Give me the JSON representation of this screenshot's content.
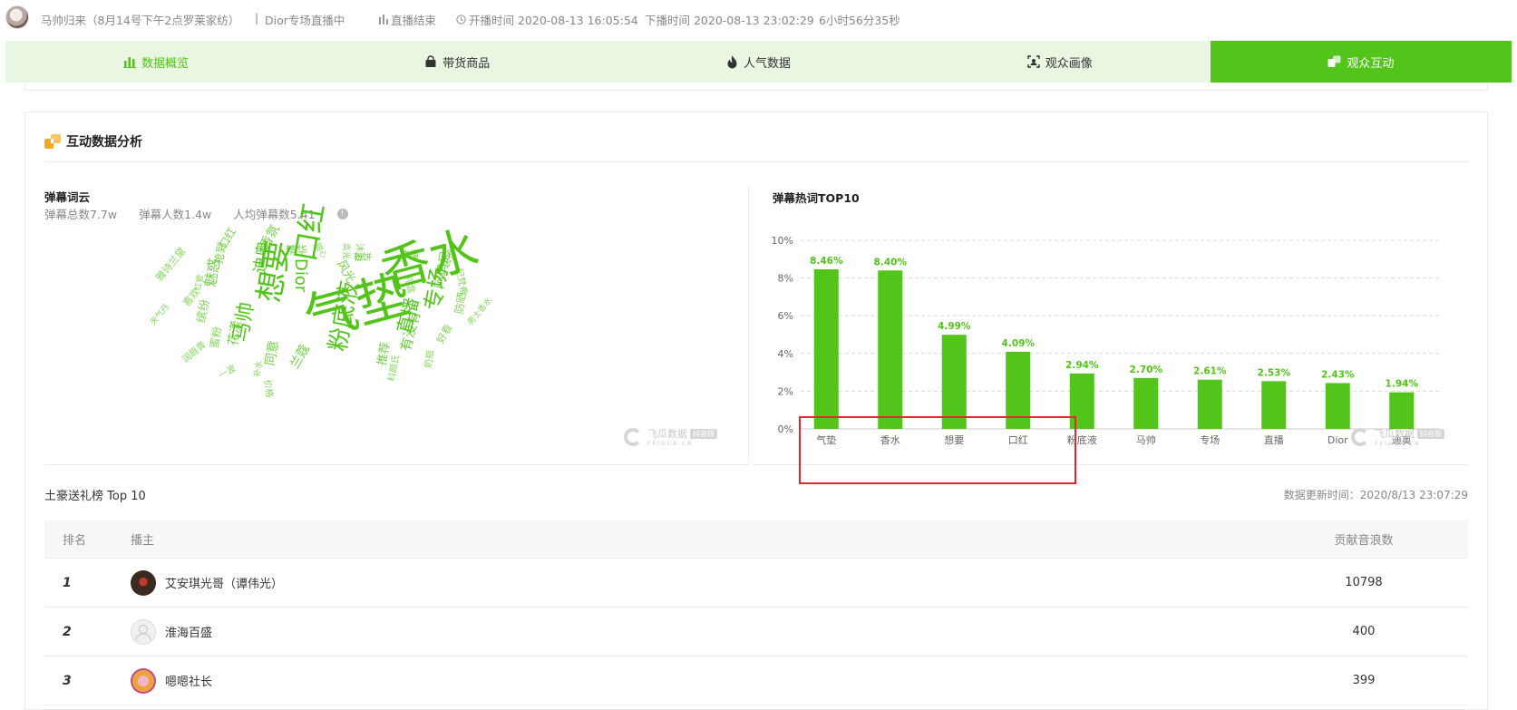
{
  "header": {
    "room_title": "马帅归来（8月14号下午2点罗莱家纺）",
    "live_topic": "Dior专场直播中",
    "live_status": "直播结束",
    "start_time": "开播时间 2020-08-13 16:05:54",
    "end_time": "下播时间 2020-08-13 23:02:29",
    "duration": "6小时56分35秒"
  },
  "tabs": [
    {
      "label": "数据概览",
      "icon": "bar-chart-icon"
    },
    {
      "label": "带货商品",
      "icon": "shopping-bag-icon"
    },
    {
      "label": "人气数据",
      "icon": "flame-icon"
    },
    {
      "label": "观众画像",
      "icon": "scan-face-icon"
    },
    {
      "label": "观众互动",
      "icon": "interaction-icon"
    }
  ],
  "section": {
    "title": "互动数据分析"
  },
  "wordcloud": {
    "title": "弹幕词云",
    "stats": [
      "弹幕总数7.7w",
      "弹幕人数1.4w",
      "人均弹幕数5.41"
    ],
    "words": [
      {
        "text": "气垫"
      },
      {
        "text": "香水"
      },
      {
        "text": "想要"
      },
      {
        "text": "口红"
      },
      {
        "text": "粉底液"
      },
      {
        "text": "马帅"
      },
      {
        "text": "专场"
      },
      {
        "text": "直播"
      },
      {
        "text": "Dior"
      },
      {
        "text": "迪奥"
      },
      {
        "text": "魅惑"
      },
      {
        "text": "有没有"
      },
      {
        "text": "同意"
      },
      {
        "text": "推荐"
      },
      {
        "text": "阿玛尼"
      },
      {
        "text": "花漾"
      },
      {
        "text": "缤纷"
      },
      {
        "text": "精华"
      },
      {
        "text": "香氛"
      },
      {
        "text": "抢到"
      },
      {
        "text": "雅诗兰黛"
      },
      {
        "text": "口红"
      },
      {
        "text": "防晒"
      },
      {
        "text": "纪梵希"
      },
      {
        "text": "男士香水"
      },
      {
        "text": "好看"
      },
      {
        "text": "粉饼"
      },
      {
        "text": "主播"
      },
      {
        "text": "去掉"
      },
      {
        "text": "礼盒"
      },
      {
        "text": "天气丹"
      },
      {
        "text": "喜欢"
      },
      {
        "text": "一波"
      },
      {
        "text": "补水"
      },
      {
        "text": "润唇膏"
      },
      {
        "text": "奶瓶"
      },
      {
        "text": "兰蔻"
      },
      {
        "text": "蜜粉"
      },
      {
        "text": "红管"
      },
      {
        "text": "风光"
      },
      {
        "text": "甜心"
      },
      {
        "text": "价格"
      },
      {
        "text": "高光"
      },
      {
        "text": "科颜氏"
      },
      {
        "text": "沐浴"
      }
    ]
  },
  "watermark": {
    "name": "飞瓜数据",
    "tag": "抖音版",
    "sub": "FEIGUA.CN"
  },
  "chart_data": {
    "type": "bar",
    "title": "弹幕热词TOP10",
    "categories": [
      "气垫",
      "香水",
      "想要",
      "口红",
      "粉底液",
      "马帅",
      "专场",
      "直播",
      "Dior",
      "迪奥"
    ],
    "values": [
      8.46,
      8.4,
      4.99,
      4.09,
      2.94,
      2.7,
      2.61,
      2.53,
      2.43,
      1.94
    ],
    "value_labels": [
      "8.46%",
      "8.40%",
      "4.99%",
      "4.09%",
      "2.94%",
      "2.70%",
      "2.61%",
      "2.53%",
      "2.43%",
      "1.94%"
    ],
    "ylim": [
      0,
      10
    ],
    "yticks": [
      "0%",
      "2%",
      "4%",
      "6%",
      "8%",
      "10%"
    ],
    "grid": true,
    "bar_color": "#52c41a"
  },
  "gift_rank": {
    "title": "土豪送礼榜 Top 10",
    "update_time": "数据更新时间：2020/8/13 23:07:29",
    "columns": [
      "排名",
      "播主",
      "贡献音浪数"
    ],
    "rows": [
      {
        "rank": "1",
        "name": "艾安琪光哥（谭伟光）",
        "value": "10798"
      },
      {
        "rank": "2",
        "name": "淮海百盛",
        "value": "400"
      },
      {
        "rank": "3",
        "name": "嗯嗯社长",
        "value": "399"
      }
    ]
  },
  "colors": {
    "accent": "#52c41a",
    "tab_bg": "#e8f6e2",
    "highlight_box": "#e8252e"
  }
}
